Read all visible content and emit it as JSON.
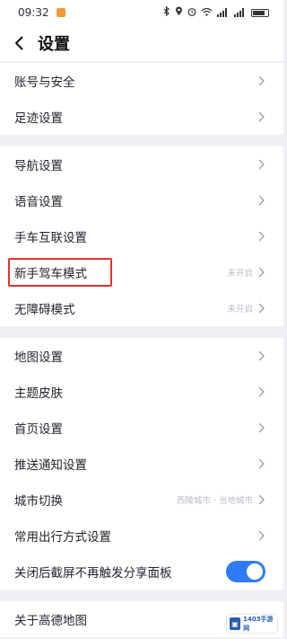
{
  "status_bar": {
    "time": "09:32"
  },
  "header": {
    "title": "设置"
  },
  "groups": [
    {
      "items": [
        {
          "label": "账号与安全"
        },
        {
          "label": "足迹设置"
        }
      ]
    },
    {
      "items": [
        {
          "label": "导航设置"
        },
        {
          "label": "语音设置"
        },
        {
          "label": "手车互联设置"
        },
        {
          "label": "新手驾车模式",
          "status": "未开启",
          "highlighted": true
        },
        {
          "label": "无障碍模式",
          "status": "未开启"
        }
      ]
    },
    {
      "items": [
        {
          "label": "地图设置"
        },
        {
          "label": "主题皮肤"
        },
        {
          "label": "首页设置"
        },
        {
          "label": "推送通知设置"
        },
        {
          "label": "城市切换",
          "status": "西陵城市 · 当地城市"
        },
        {
          "label": "常用出行方式设置"
        },
        {
          "label": "关闭后截屏不再触发分享面板",
          "toggle": true,
          "toggle_on": true
        }
      ]
    },
    {
      "items": [
        {
          "label": "关于高德地图"
        }
      ]
    }
  ],
  "watermark": {
    "text": "1403手游网",
    "mark": "▣"
  },
  "colors": {
    "highlight_border": "#e4322d",
    "toggle_on": "#2f7bf6",
    "background": "#eef0f3"
  }
}
